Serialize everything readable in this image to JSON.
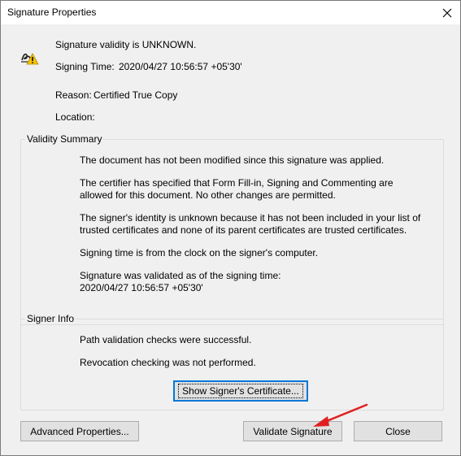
{
  "window": {
    "title": "Signature Properties",
    "close_icon": "close-icon"
  },
  "header": {
    "validity": "Signature validity is UNKNOWN.",
    "signing_time_label": "Signing Time:",
    "signing_time_value": "2020/04/27 10:56:57 +05'30'",
    "reason_label": "Reason:",
    "reason_value": "Certified True Copy",
    "location_label": "Location:",
    "location_value": "",
    "status_icon": "signature-warning-icon"
  },
  "validity_summary": {
    "title": "Validity Summary",
    "p1": "The document has not been modified since this signature was applied.",
    "p2_line1": "The certifier has specified that Form Fill-in, Signing and Commenting are",
    "p2_line2": "allowed for this document. No other changes are permitted.",
    "p3_line1": "The signer's identity is unknown because it has not been included in your list of",
    "p3_line2": "trusted certificates and none of its parent certificates are trusted certificates.",
    "p4": "Signing time is from the clock on the signer's computer.",
    "p5_line1": "Signature was validated as of the signing time:",
    "p5_line2": "2020/04/27 10:56:57 +05'30'"
  },
  "signer_info": {
    "title": "Signer Info",
    "p1": "Path validation checks were successful.",
    "p2": "Revocation checking was not performed.",
    "show_cert_button": "Show Signer's Certificate..."
  },
  "footer": {
    "advanced_button": "Advanced Properties...",
    "validate_button": "Validate Signature",
    "close_button": "Close"
  },
  "colors": {
    "dialog_bg": "#f0f0f0",
    "button_bg": "#e1e1e1",
    "focus_border": "#0078d7",
    "annotation_arrow": "#e02020",
    "warning_yellow": "#f5c400"
  }
}
